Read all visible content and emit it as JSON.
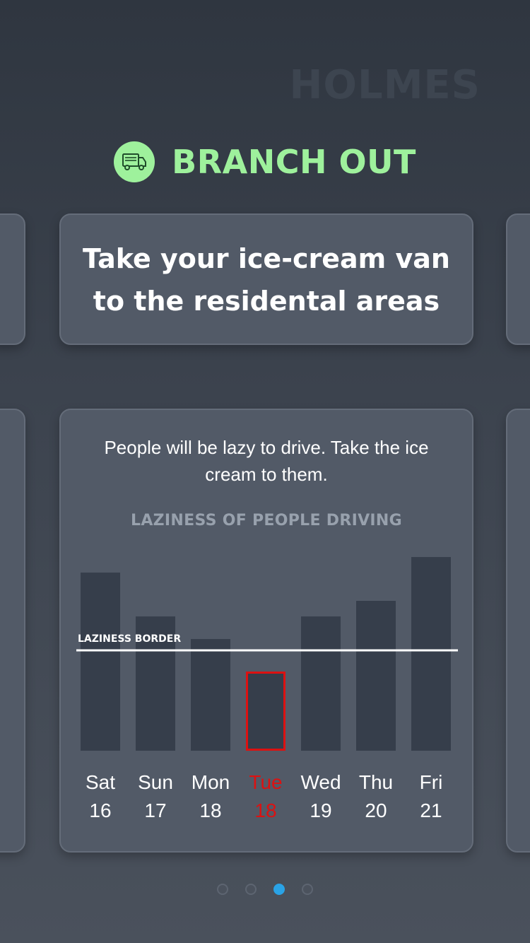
{
  "brand": "HOLMES",
  "header": {
    "title": "BRANCH OUT",
    "icon": "van-icon"
  },
  "tip_card": {
    "text_line1": "Take your ice-cream van",
    "text_line2": "to the residental areas"
  },
  "detail_card": {
    "description": "People will be lazy to drive. Take the ice cream to them.",
    "highlight_color": "#dd1111"
  },
  "chart_data": {
    "type": "bar",
    "title": "LAZINESS OF PEOPLE DRIVING",
    "categories": [
      "Sat 16",
      "Sun 17",
      "Mon 18",
      "Tue 18",
      "Wed 19",
      "Thu 20",
      "Fri 21"
    ],
    "days": [
      "Sat",
      "Sun",
      "Mon",
      "Tue",
      "Wed",
      "Thu",
      "Fri"
    ],
    "dates": [
      "16",
      "17",
      "18",
      "18",
      "19",
      "20",
      "21"
    ],
    "values": [
      252,
      190,
      158,
      112,
      190,
      212,
      274
    ],
    "ylim": [
      0,
      300
    ],
    "threshold": {
      "label": "LAZINESS BORDER",
      "value": 142
    },
    "highlight_index": 3
  },
  "pagination": {
    "total": 4,
    "active": 2
  }
}
